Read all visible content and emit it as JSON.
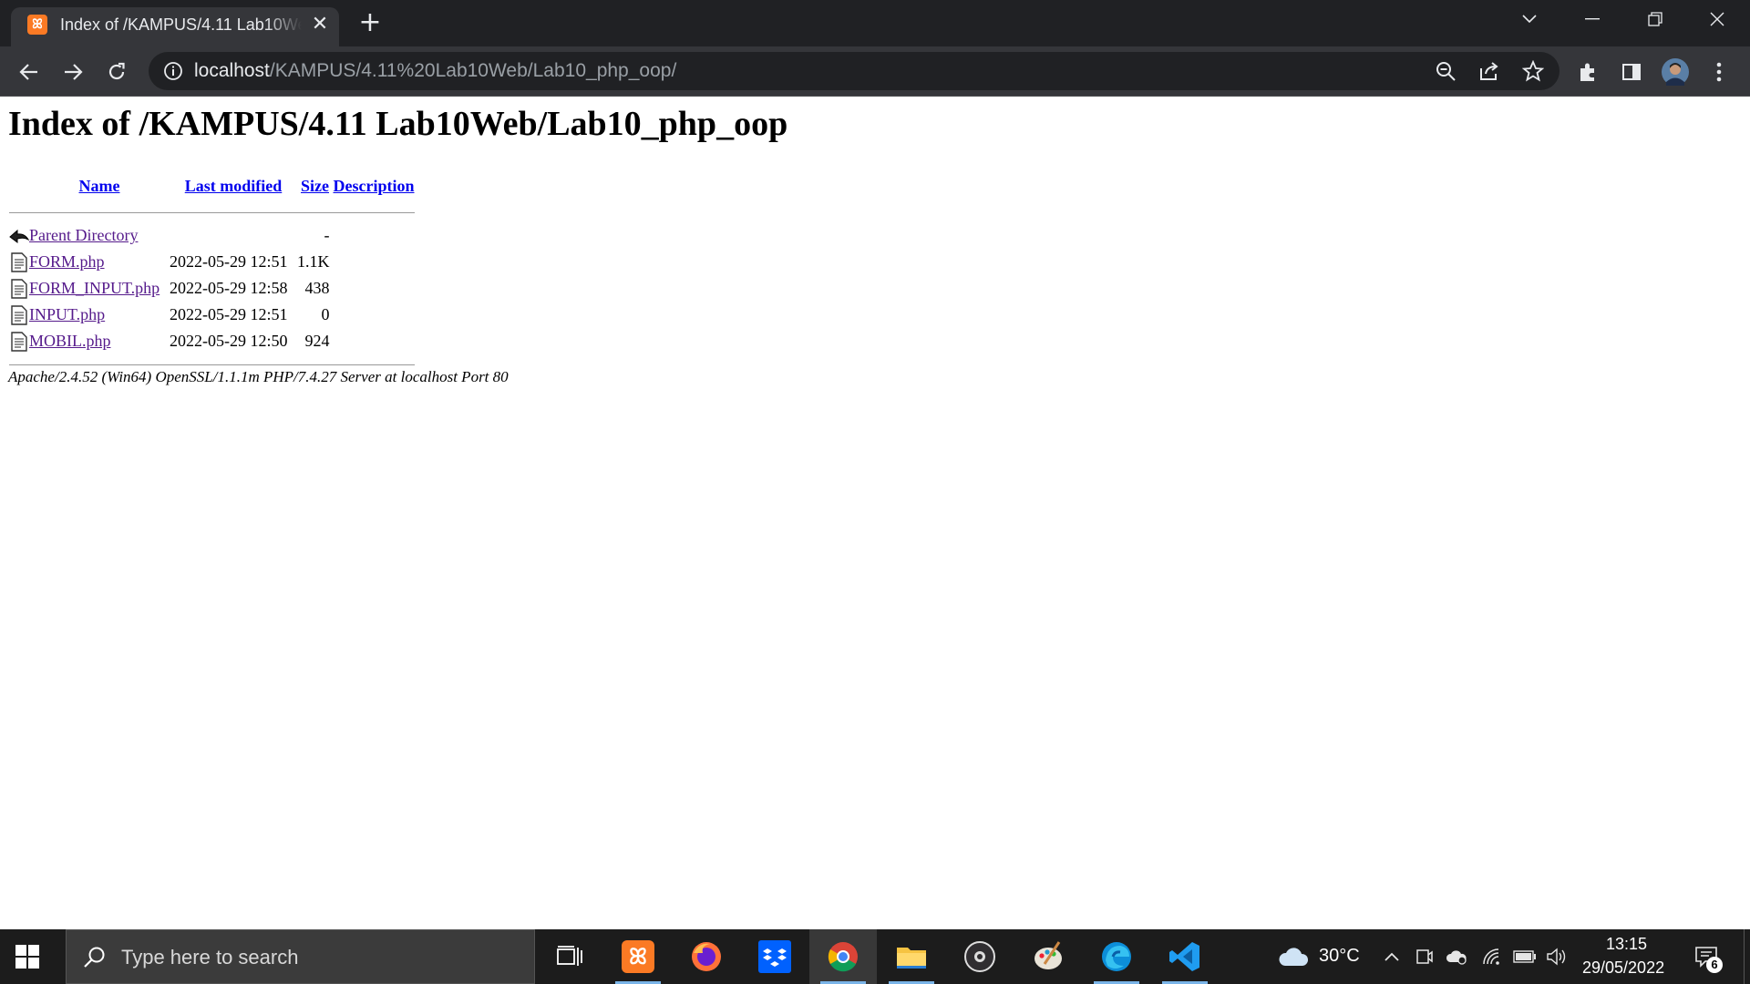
{
  "browser": {
    "tab_title": "Index of /KAMPUS/4.11 Lab10Web/Lab10_php_oop",
    "new_tab_symbol": "+",
    "close_tab_symbol": "✕",
    "url_host": "localhost",
    "url_path": "/KAMPUS/4.11%20Lab10Web/Lab10_php_oop/"
  },
  "page": {
    "heading": "Index of /KAMPUS/4.11 Lab10Web/Lab10_php_oop",
    "columns": {
      "name": "Name",
      "last_modified": "Last modified",
      "size": "Size",
      "description": "Description"
    },
    "parent": {
      "label": "Parent Directory",
      "size": "-"
    },
    "files": [
      {
        "name": "FORM.php",
        "modified": "2022-05-29 12:51",
        "size": "1.1K"
      },
      {
        "name": "FORM_INPUT.php",
        "modified": "2022-05-29 12:58",
        "size": "438"
      },
      {
        "name": "INPUT.php",
        "modified": "2022-05-29 12:51",
        "size": "0"
      },
      {
        "name": "MOBIL.php",
        "modified": "2022-05-29 12:50",
        "size": "924"
      }
    ],
    "address": "Apache/2.4.52 (Win64) OpenSSL/1.1.1m PHP/7.4.27 Server at localhost Port 80"
  },
  "taskbar": {
    "search_placeholder": "Type here to search",
    "weather": "30°C",
    "time": "13:15",
    "date": "29/05/2022",
    "notifications": "6",
    "apps": [
      "task-view",
      "xampp",
      "firefox",
      "dropbox",
      "chrome",
      "file-explorer",
      "obs",
      "paint",
      "edge",
      "vscode"
    ]
  },
  "colors": {
    "link": "#0000ee",
    "visited": "#551a8b",
    "tab_bg": "#35363a",
    "titlebar_bg": "#202124",
    "taskbar_bg": "#1c1c1c"
  }
}
